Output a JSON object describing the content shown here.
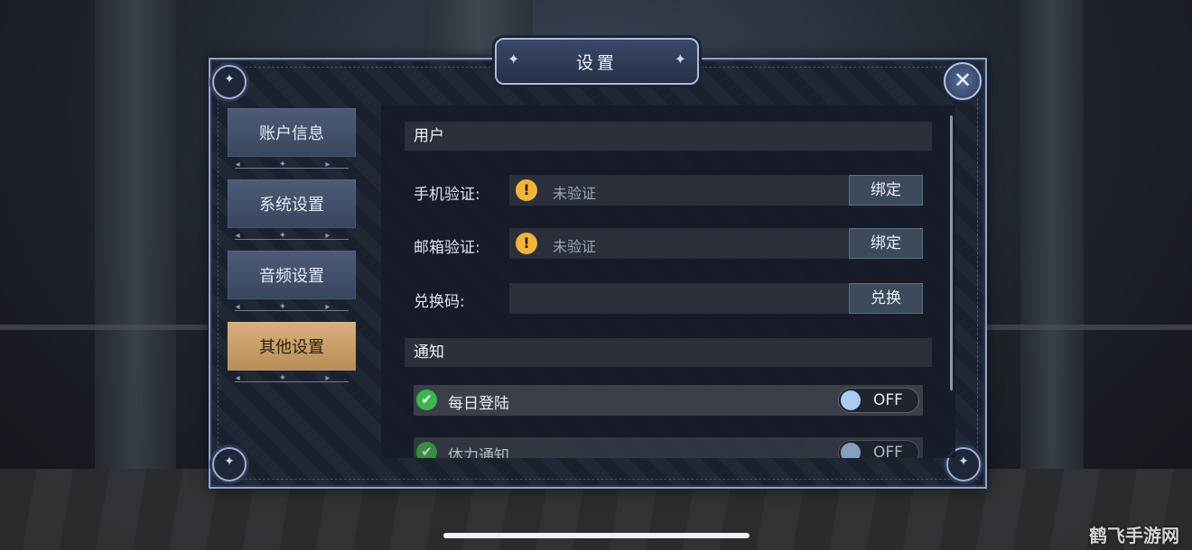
{
  "dialog": {
    "title": "设置",
    "close_symbol": "✕"
  },
  "sidebar": {
    "items": [
      {
        "label": "账户信息",
        "active": false
      },
      {
        "label": "系统设置",
        "active": false
      },
      {
        "label": "音频设置",
        "active": false
      },
      {
        "label": "其他设置",
        "active": true
      }
    ]
  },
  "user_section": {
    "header": "用户",
    "phone": {
      "label": "手机验证:",
      "status": "未验证",
      "button": "绑定",
      "icon": "warning-icon"
    },
    "email": {
      "label": "邮箱验证:",
      "status": "未验证",
      "button": "绑定",
      "icon": "warning-icon"
    },
    "redeem": {
      "label": "兑换码:",
      "value": "",
      "button": "兑换"
    }
  },
  "notify_section": {
    "header": "通知",
    "toggles": [
      {
        "label": "每日登陆",
        "state": "OFF",
        "enabled": false
      },
      {
        "label": "体力通知",
        "state": "OFF",
        "enabled": false
      }
    ]
  },
  "watermark": "鹤飞手游网",
  "colors": {
    "accent_active": "#c99d68",
    "panel_border": "#8fa3c8",
    "warn": "#f0b43a",
    "check": "#3fb54d"
  }
}
